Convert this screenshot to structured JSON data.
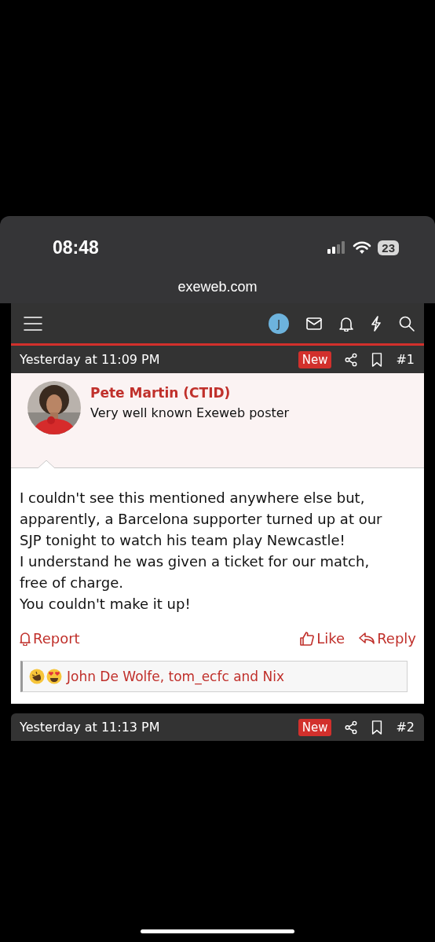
{
  "status_bar": {
    "time": "08:48",
    "battery": "23"
  },
  "browser": {
    "url": "exeweb.com"
  },
  "nav": {
    "avatar_letter": "J"
  },
  "posts": [
    {
      "date": "Yesterday at 11:09 PM",
      "badge": "New",
      "number": "#1",
      "author": "Pete Martin (CTID)",
      "user_title": "Very well known Exeweb poster",
      "body": [
        "I couldn't see this mentioned anywhere else but, apparently, a Barcelona supporter turned up at our SJP tonight to watch his team play Newcastle!",
        "I understand he was given a ticket for our match, free of charge.",
        "You couldn't make it up!"
      ],
      "report": "Report",
      "like": "Like",
      "reply": "Reply",
      "reactions": "John De Wolfe, tom_ecfc and Nix"
    },
    {
      "date": "Yesterday at 11:13 PM",
      "badge": "New",
      "number": "#2"
    }
  ]
}
